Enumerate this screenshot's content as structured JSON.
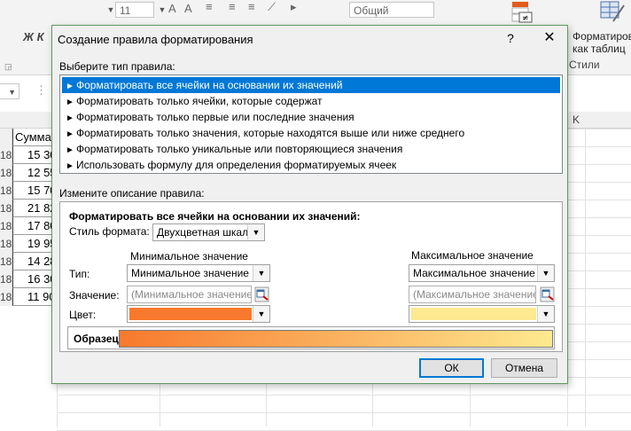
{
  "ribbon": {
    "font_size": "11",
    "number_format": "Общий",
    "bold_italic": "Ж К",
    "format_as_table": "Форматиров как таблиц",
    "styles_group": "Стили"
  },
  "sheet": {
    "column_k": "K",
    "header_cell": "Сумма",
    "row_label": "18",
    "values": [
      "15 30",
      "12 55",
      "15 70",
      "21 82",
      "17 80",
      "19 95",
      "14 28",
      "16 30",
      "11 90"
    ]
  },
  "dialog": {
    "title": "Создание правила форматирования",
    "help": "?",
    "close": "✕",
    "select_type_label": "Выберите тип правила:",
    "rule_types": [
      "Форматировать все ячейки на основании их значений",
      "Форматировать только ячейки, которые содержат",
      "Форматировать только первые или последние значения",
      "Форматировать только значения, которые находятся выше или ниже среднего",
      "Форматировать только уникальные или повторяющиеся значения",
      "Использовать формулу для определения форматируемых ячеек"
    ],
    "edit_desc_label": "Измените описание правила:",
    "desc_title": "Форматировать все ячейки на основании их значений:",
    "format_style_label": "Стиль формата:",
    "format_style_value": "Двухцветная шкала",
    "min_header": "Минимальное значение",
    "max_header": "Максимальное значение",
    "type_label": "Тип:",
    "value_label": "Значение:",
    "color_label": "Цвет:",
    "min_type": "Минимальное значение",
    "max_type": "Максимальное значение",
    "min_value_placeholder": "(Минимальное значение)",
    "max_value_placeholder": "(Максимальное значение)",
    "min_color": "#f8792d",
    "max_color": "#fde98f",
    "preview_label": "Образец:",
    "ok": "ОК",
    "cancel": "Отмена"
  }
}
